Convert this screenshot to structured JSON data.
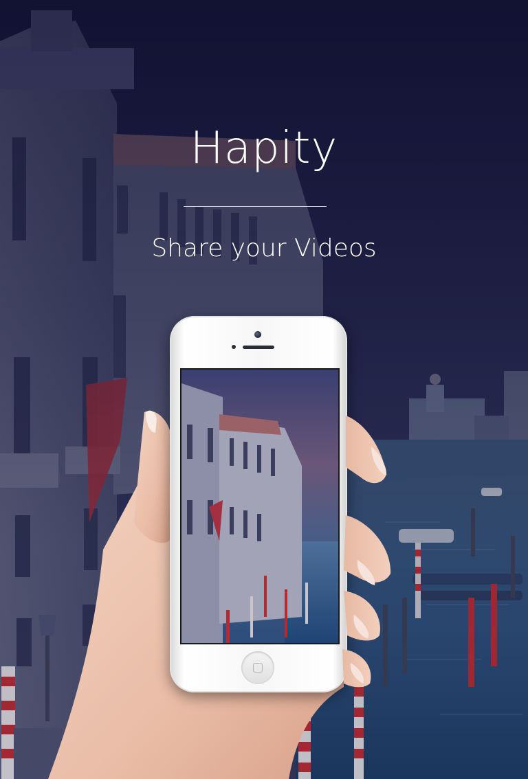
{
  "app": {
    "title": "Hapity",
    "tagline": "Share your Videos"
  },
  "colors": {
    "background_top": "#17173a",
    "background_bottom": "#1b2c4a",
    "text": "#ffffff",
    "water": "#2a4f7a",
    "pole_red": "#b42a33"
  },
  "icons": {
    "phone": "smartphone-illustration",
    "home_button": "home-button-icon"
  }
}
